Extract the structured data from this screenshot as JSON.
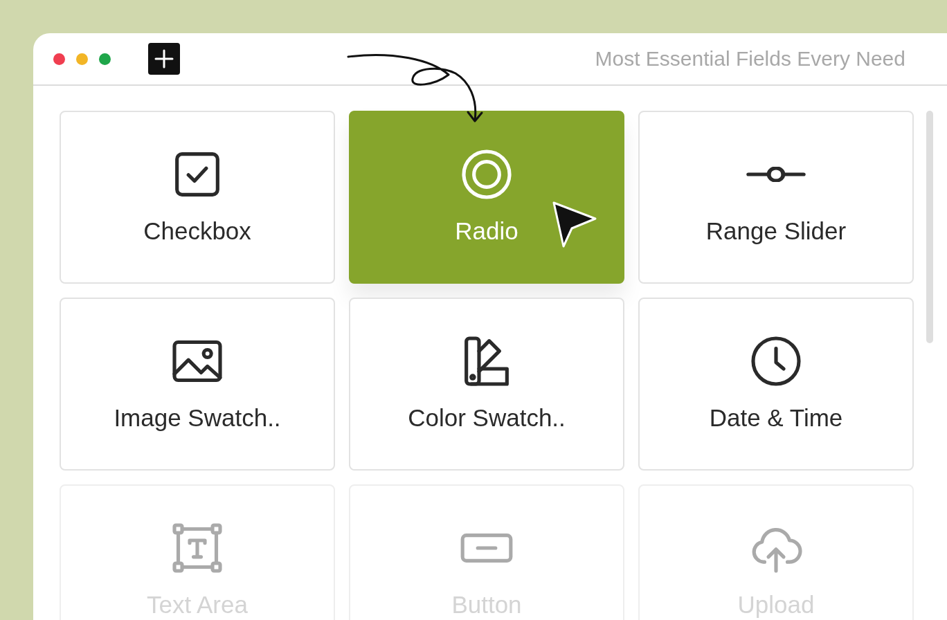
{
  "window": {
    "title": "Most Essential Fields Every Need"
  },
  "cards": [
    {
      "kind": "checkbox",
      "label": "Checkbox",
      "selected": false,
      "dimmed": false
    },
    {
      "kind": "radio",
      "label": "Radio",
      "selected": true,
      "dimmed": false
    },
    {
      "kind": "slider",
      "label": "Range Slider",
      "selected": false,
      "dimmed": false
    },
    {
      "kind": "image",
      "label": "Image Swatch..",
      "selected": false,
      "dimmed": false
    },
    {
      "kind": "color",
      "label": "Color Swatch..",
      "selected": false,
      "dimmed": false
    },
    {
      "kind": "clock",
      "label": "Date & Time",
      "selected": false,
      "dimmed": false
    },
    {
      "kind": "textarea",
      "label": "Text Area",
      "selected": false,
      "dimmed": true
    },
    {
      "kind": "button",
      "label": "Button",
      "selected": false,
      "dimmed": true
    },
    {
      "kind": "upload",
      "label": "Upload",
      "selected": false,
      "dimmed": true
    }
  ]
}
